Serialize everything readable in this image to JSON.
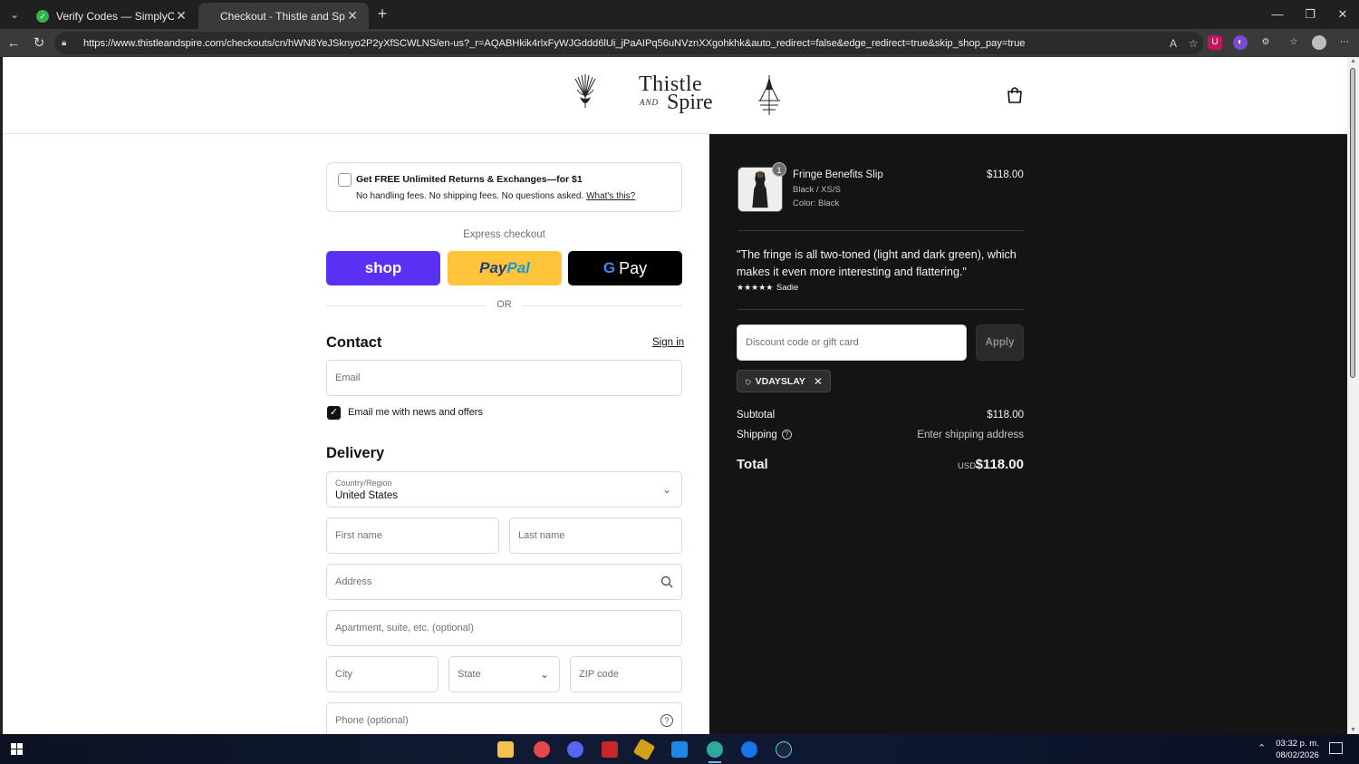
{
  "browser": {
    "tabs": [
      {
        "title": "Verify Codes — SimplyCodes",
        "close": "✕"
      },
      {
        "title": "Checkout - Thistle and Spire",
        "close": "✕"
      }
    ],
    "new_tab": "+",
    "url": "https://www.thistleandspire.com/checkouts/cn/hWN8YeJSknyo2P2yXfSCWLNS/en-us?_r=AQABHkik4rlxFyWJGddd6lUi_jPaAIPq56uNVznXXgohkhk&auto_redirect=false&edge_redirect=true&skip_shop_pay=true"
  },
  "header": {
    "brand_line1": "Thistle",
    "brand_and": "AND",
    "brand_line2": "Spire"
  },
  "upsell": {
    "title": "Get FREE Unlimited Returns & Exchanges—for $1",
    "text": "No handling fees. No shipping fees. No questions asked.",
    "link": "What's this?"
  },
  "express": {
    "label": "Express checkout",
    "shop": "shop",
    "paypal_a": "Pay",
    "paypal_b": "Pal",
    "gpay_g": "G",
    "gpay_text": "Pay",
    "or": "OR"
  },
  "contact": {
    "heading": "Contact",
    "sign_in": "Sign in",
    "email_placeholder": "Email",
    "newsletter": "Email me with news and offers",
    "newsletter_checked": true
  },
  "delivery": {
    "heading": "Delivery",
    "country_label": "Country/Region",
    "country_value": "United States",
    "first_name": "First name",
    "last_name": "Last name",
    "address": "Address",
    "apartment": "Apartment, suite, etc. (optional)",
    "city": "City",
    "state": "State",
    "zip": "ZIP code",
    "phone": "Phone (optional)"
  },
  "order": {
    "quantity": "1",
    "product_name": "Fringe Benefits Slip",
    "variant": "Black / XS/S",
    "color": "Color: Black",
    "price": "$118.00",
    "quote": "\"The fringe is all two-toned (light and dark green), which makes it even more interesting and flattering.\"",
    "stars": "★★★★★",
    "reviewer": "Sadie",
    "discount_placeholder": "Discount code or gift card",
    "apply": "Apply",
    "code": "VDAYSLAY",
    "subtotal_label": "Subtotal",
    "subtotal": "$118.00",
    "shipping_label": "Shipping",
    "shipping_value": "Enter shipping address",
    "total_label": "Total",
    "currency": "USD",
    "total": "$118.00"
  },
  "taskbar": {
    "time": "03:32 p. m.",
    "date": "08/02/2026"
  }
}
